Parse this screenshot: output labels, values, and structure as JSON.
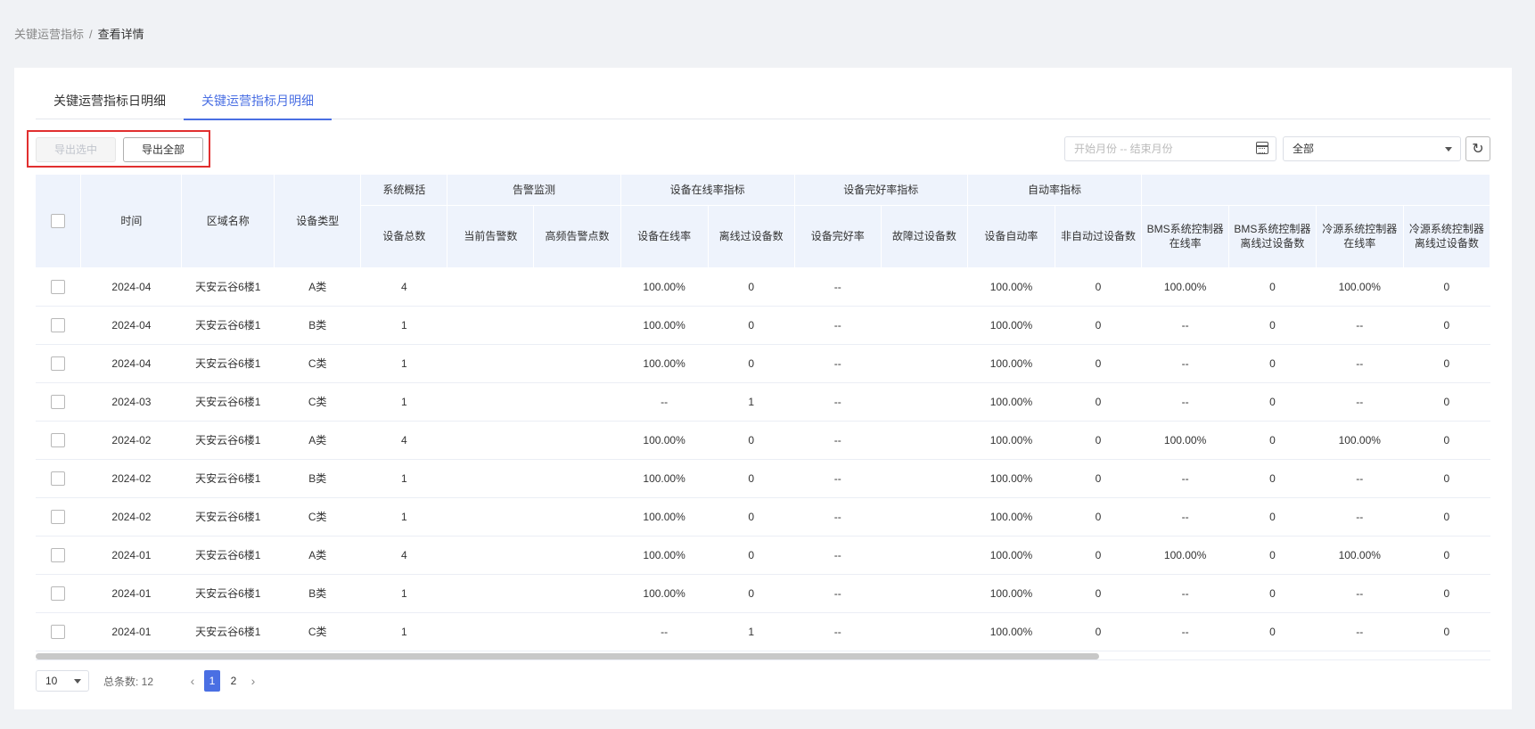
{
  "breadcrumb": {
    "parent": "关键运营指标",
    "separator": "/",
    "current": "查看详情"
  },
  "tabs": [
    {
      "label": "关键运营指标日明细",
      "active": false
    },
    {
      "label": "关键运营指标月明细",
      "active": true
    }
  ],
  "toolbar": {
    "export_selected": "导出选中",
    "export_all": "导出全部",
    "date_range_placeholder": "开始月份 -- 结束月份",
    "filter_value": "全部"
  },
  "table": {
    "group_headers": [
      "系统概括",
      "告警监测",
      "设备在线率指标",
      "设备完好率指标",
      "自动率指标",
      ""
    ],
    "fixed_headers": [
      "时间",
      "区域名称",
      "设备类型"
    ],
    "sub_headers": [
      "设备总数",
      "当前告警数",
      "高频告警点数",
      "设备在线率",
      "离线过设备数",
      "设备完好率",
      "故障过设备数",
      "设备自动率",
      "非自动过设备数",
      "BMS系统控制器在线率",
      "BMS系统控制器离线过设备数",
      "冷源系统控制器在线率",
      "冷源系统控制器离线过设备数"
    ],
    "rows": [
      [
        "2024-04",
        "天安云谷6楼1",
        "A类",
        "4",
        "",
        "",
        "100.00%",
        "0",
        "--",
        "",
        "100.00%",
        "0",
        "100.00%",
        "0",
        "100.00%",
        "0"
      ],
      [
        "2024-04",
        "天安云谷6楼1",
        "B类",
        "1",
        "",
        "",
        "100.00%",
        "0",
        "--",
        "",
        "100.00%",
        "0",
        "--",
        "0",
        "--",
        "0"
      ],
      [
        "2024-04",
        "天安云谷6楼1",
        "C类",
        "1",
        "",
        "",
        "100.00%",
        "0",
        "--",
        "",
        "100.00%",
        "0",
        "--",
        "0",
        "--",
        "0"
      ],
      [
        "2024-03",
        "天安云谷6楼1",
        "C类",
        "1",
        "",
        "",
        "--",
        "1",
        "--",
        "",
        "100.00%",
        "0",
        "--",
        "0",
        "--",
        "0"
      ],
      [
        "2024-02",
        "天安云谷6楼1",
        "A类",
        "4",
        "",
        "",
        "100.00%",
        "0",
        "--",
        "",
        "100.00%",
        "0",
        "100.00%",
        "0",
        "100.00%",
        "0"
      ],
      [
        "2024-02",
        "天安云谷6楼1",
        "B类",
        "1",
        "",
        "",
        "100.00%",
        "0",
        "--",
        "",
        "100.00%",
        "0",
        "--",
        "0",
        "--",
        "0"
      ],
      [
        "2024-02",
        "天安云谷6楼1",
        "C类",
        "1",
        "",
        "",
        "100.00%",
        "0",
        "--",
        "",
        "100.00%",
        "0",
        "--",
        "0",
        "--",
        "0"
      ],
      [
        "2024-01",
        "天安云谷6楼1",
        "A类",
        "4",
        "",
        "",
        "100.00%",
        "0",
        "--",
        "",
        "100.00%",
        "0",
        "100.00%",
        "0",
        "100.00%",
        "0"
      ],
      [
        "2024-01",
        "天安云谷6楼1",
        "B类",
        "1",
        "",
        "",
        "100.00%",
        "0",
        "--",
        "",
        "100.00%",
        "0",
        "--",
        "0",
        "--",
        "0"
      ],
      [
        "2024-01",
        "天安云谷6楼1",
        "C类",
        "1",
        "",
        "",
        "--",
        "1",
        "--",
        "",
        "100.00%",
        "0",
        "--",
        "0",
        "--",
        "0"
      ]
    ]
  },
  "pagination": {
    "page_size": "10",
    "total_label": "总条数: 12",
    "pages": [
      "1",
      "2"
    ],
    "current_page": "1"
  },
  "colors": {
    "accent": "#4a6fe3",
    "highlight_box": "#e12f2f",
    "header_bg": "#eef3fc"
  }
}
